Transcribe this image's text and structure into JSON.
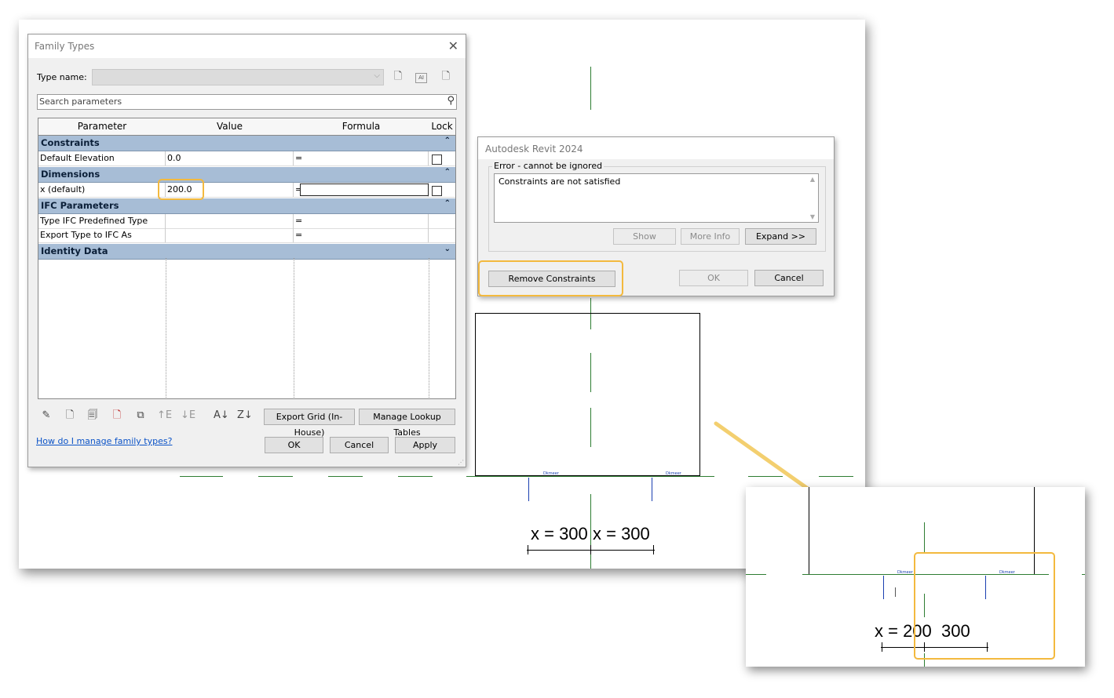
{
  "family_types": {
    "title": "Family Types",
    "type_name_label": "Type name:",
    "search_placeholder": "Search parameters",
    "columns": [
      "Parameter",
      "Value",
      "Formula",
      "Lock"
    ],
    "groups": {
      "constraints": "Constraints",
      "dimensions": "Dimensions",
      "ifc": "IFC Parameters",
      "identity": "Identity Data"
    },
    "rows": {
      "default_elevation": {
        "param": "Default Elevation",
        "value": "0.0",
        "formula": "="
      },
      "x_default": {
        "param": "x (default)",
        "value": "200.0",
        "formula": "="
      },
      "ifc_type": {
        "param": "Type IFC Predefined Type",
        "value": "",
        "formula": "="
      },
      "export_type": {
        "param": "Export Type to IFC As",
        "value": "",
        "formula": "="
      }
    },
    "export_grid": "Export Grid (In-House)",
    "manage_lookup": "Manage Lookup Tables",
    "help_link": "How do I manage family types?",
    "ok": "OK",
    "cancel": "Cancel",
    "apply": "Apply"
  },
  "error_dialog": {
    "title": "Autodesk Revit 2024",
    "group_label": "Error - cannot be ignored",
    "message": "Constraints are not satisfied",
    "show": "Show",
    "more_info": "More Info",
    "expand": "Expand >>",
    "remove_constraints": "Remove Constraints",
    "ok": "OK",
    "cancel": "Cancel"
  },
  "drawing": {
    "dim_left": "x = 300",
    "dim_right": "x = 300",
    "zoom_dim": "x = 200  300",
    "tiny_label": "Dkmeer"
  },
  "colors": {
    "highlight": "#f3b93e",
    "group_band": "#a7bdd6",
    "ref_line": "#2e7d32",
    "link": "#0b53c7"
  }
}
